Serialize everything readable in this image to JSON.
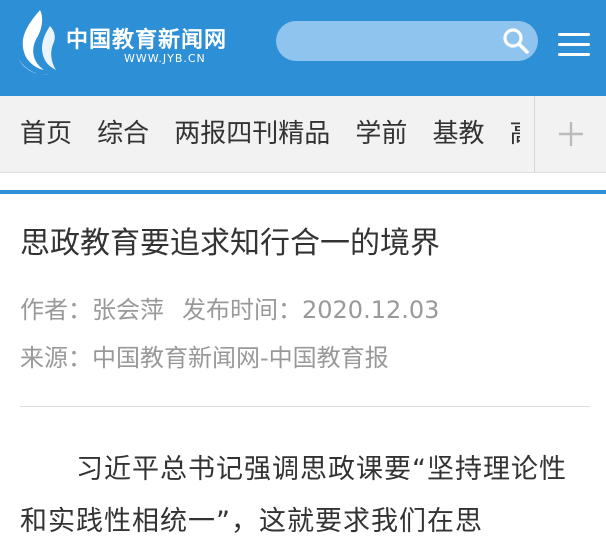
{
  "header": {
    "logo_text": "中国教育新闻网",
    "logo_url": "WWW.JYB.CN",
    "search_placeholder": "",
    "colors": {
      "bar": "#2d8fd6",
      "search_bg": "#8fc4ef"
    },
    "icons": {
      "logo": "flame-logo-icon",
      "search": "search-icon",
      "menu": "hamburger-menu-icon"
    }
  },
  "nav": {
    "items": [
      "首页",
      "综合",
      "两报四刊精品",
      "学前",
      "基教",
      "高"
    ],
    "expand_icon": "plus-icon"
  },
  "article": {
    "title": "思政教育要追求知行合一的境界",
    "author_label": "作者：张会萍",
    "date_label": "发布时间：2020.12.03",
    "source_label": "来源：中国教育新闻网-中国教育报",
    "paragraph": "习近平总书记强调思政课要“坚持理论性和实践性相统一”，这就要求我们在思"
  }
}
